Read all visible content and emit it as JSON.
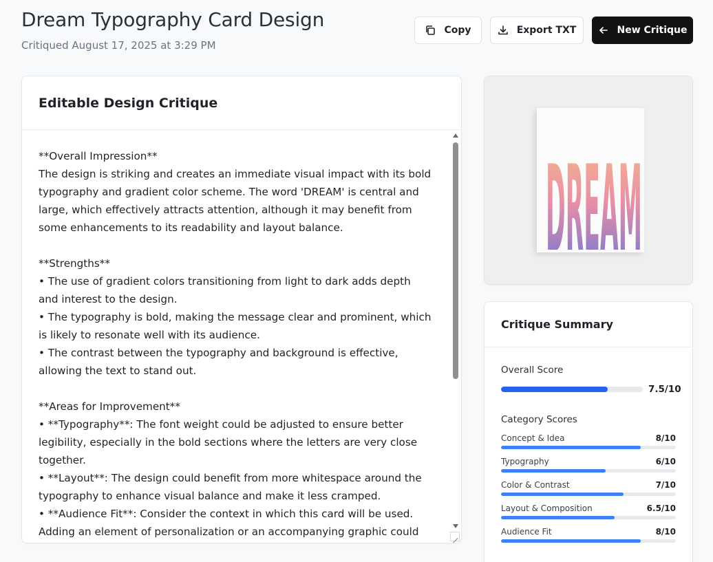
{
  "header": {
    "title": "Dream Typography Card Design",
    "subtitle": "Critiqued August 17, 2025 at 3:29 PM"
  },
  "toolbar": {
    "copy_label": "Copy",
    "copy_icon": "copy-icon",
    "export_label": "Export TXT",
    "export_icon": "download-icon",
    "new_label": "New Critique",
    "new_icon": "arrow-left-icon"
  },
  "editor": {
    "title": "Editable Design Critique",
    "text": "**Overall Impression**\nThe design is striking and creates an immediate visual impact with its bold typography and gradient color scheme. The word 'DREAM' is central and large, which effectively attracts attention, although it may benefit from some enhancements to its readability and layout balance.\n\n**Strengths**\n• The use of gradient colors transitioning from light to dark adds depth and interest to the design.\n• The typography is bold, making the message clear and prominent, which is likely to resonate well with its audience.\n• The contrast between the typography and background is effective, allowing the text to stand out.\n\n**Areas for Improvement**\n• **Typography**: The font weight could be adjusted to ensure better legibility, especially in the bold sections where the letters are very close together.\n• **Layout**: The design could benefit from more whitespace around the typography to enhance visual balance and make it less cramped.\n• **Audience Fit**: Consider the context in which this card will be used. Adding an element of personalization or an accompanying graphic could enhance its emotional resonance with the audience."
  },
  "preview": {
    "word": "DREAM",
    "gradient_top": "#f6b98a",
    "gradient_mid": "#e98fa6",
    "gradient_bottom": "#5f73d9"
  },
  "summary": {
    "title": "Critique Summary",
    "overall_label": "Overall Score",
    "overall_score": 7.5,
    "overall_max": 10,
    "overall_display": "7.5/10",
    "category_label": "Category Scores",
    "categories": [
      {
        "name": "Concept & Idea",
        "score": 8,
        "display": "8/10"
      },
      {
        "name": "Typography",
        "score": 6,
        "display": "6/10"
      },
      {
        "name": "Color & Contrast",
        "score": 7,
        "display": "7/10"
      },
      {
        "name": "Layout & Composition",
        "score": 6.5,
        "display": "6.5/10"
      },
      {
        "name": "Audience Fit",
        "score": 8,
        "display": "8/10"
      }
    ]
  },
  "colors": {
    "primary_bar": "#2563eb",
    "category_bar": "#3b82f6",
    "dark_button": "#111214"
  }
}
